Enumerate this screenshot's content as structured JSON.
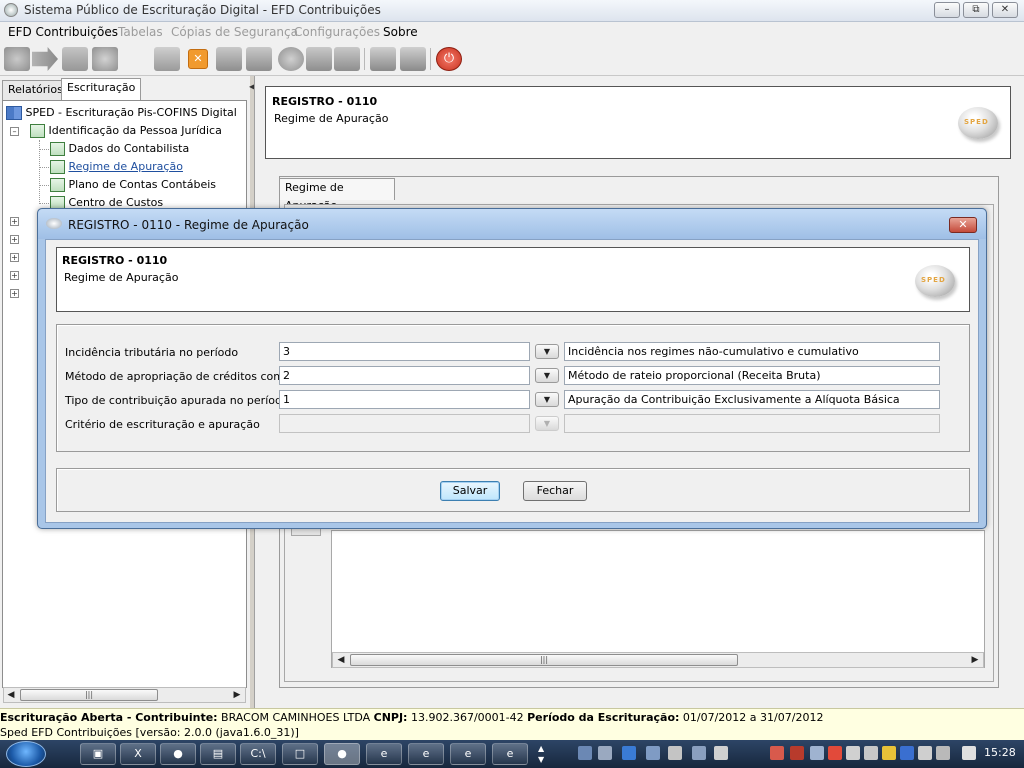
{
  "window": {
    "title": "Sistema Público de Escrituração Digital - EFD Contribuições"
  },
  "menu": [
    {
      "label": "EFD Contribuições",
      "enabled": true
    },
    {
      "label": "Tabelas",
      "enabled": false
    },
    {
      "label": "Cópias de Segurança",
      "enabled": false
    },
    {
      "label": "Configurações",
      "enabled": false
    },
    {
      "label": "Sobre",
      "enabled": true
    }
  ],
  "left_tabs": [
    "Relatórios",
    "Escrituração"
  ],
  "tree": {
    "root": "SPED - Escrituração Pis-COFINS Digital",
    "group": "Identificação da Pessoa Jurídica",
    "items": [
      "Dados do Contabilista",
      "Regime de Apuração",
      "Plano de Contas Contábeis",
      "Centro de Custos"
    ]
  },
  "right_header": {
    "title": "REGISTRO - 0110",
    "subtitle": "Regime de Apuração"
  },
  "right_tab": "Regime de Apuração",
  "dialog": {
    "title": "REGISTRO - 0110 - Regime de Apuração",
    "header_title": "REGISTRO - 0110",
    "header_subtitle": "Regime de Apuração",
    "fields": [
      {
        "label": "Incidência tributária no período",
        "code": "3",
        "description": "Incidência nos regimes não-cumulativo e cumulativo",
        "enabled": true
      },
      {
        "label": "Método de apropriação de créditos comuns",
        "code": "2",
        "description": "Método de rateio proporcional (Receita Bruta)",
        "enabled": true
      },
      {
        "label": "Tipo de contribuição apurada no período",
        "code": "1",
        "description": "Apuração da Contribuição Exclusivamente a Alíquota Básica",
        "enabled": true
      },
      {
        "label": "Critério de escrituração e apuração",
        "code": "",
        "description": "",
        "enabled": false
      }
    ],
    "save_label": "Salvar",
    "close_label": "Fechar"
  },
  "status": {
    "line1_a": "Escrituração Aberta - Contribuinte:",
    "line1_b": " BRACOM CAMINHOES LTDA ",
    "line1_c": "CNPJ:",
    "line1_d": " 13.902.367/0001-42 ",
    "line1_e": "Período da Escrituração:",
    "line1_f": " 01/07/2012 a 31/07/2012",
    "line2": "Sped EFD Contribuições [versão: 2.0.0 (java1.6.0_31)]"
  },
  "taskbar": {
    "clock": "15:28"
  },
  "colors": {
    "link_blue": "#1f4f9f",
    "dialog_frame": "#a9c6e8",
    "status_bg": "#ffffe1"
  }
}
